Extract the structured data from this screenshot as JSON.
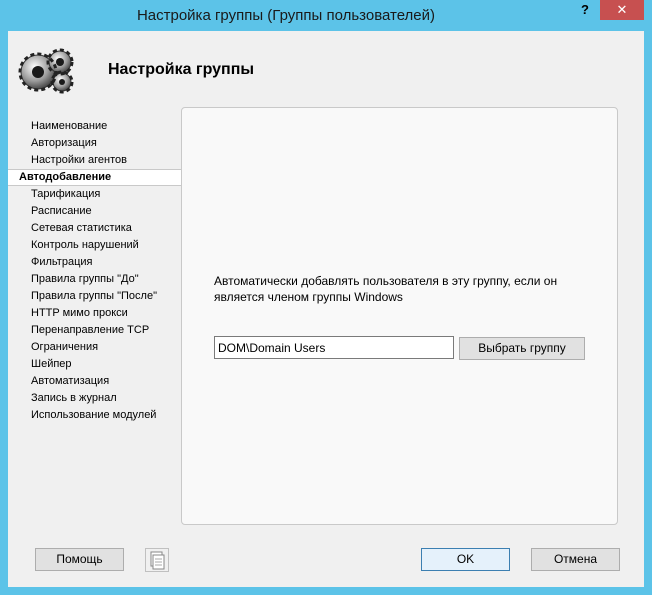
{
  "window": {
    "title": "Настройка группы (Группы пользователей)",
    "help_glyph": "?",
    "close_glyph": "✕"
  },
  "header": {
    "title": "Настройка группы",
    "icon": "gears-icon"
  },
  "nav": {
    "items": [
      {
        "label": "Наименование"
      },
      {
        "label": "Авторизация"
      },
      {
        "label": "Настройки агентов"
      },
      {
        "label": "Автодобавление"
      },
      {
        "label": "Тарификация"
      },
      {
        "label": "Расписание"
      },
      {
        "label": "Сетевая статистика"
      },
      {
        "label": "Контроль нарушений"
      },
      {
        "label": "Фильтрация"
      },
      {
        "label": "Правила группы \"До\""
      },
      {
        "label": "Правила группы \"После\""
      },
      {
        "label": "HTTP мимо прокси"
      },
      {
        "label": "Перенаправление TCP"
      },
      {
        "label": "Ограничения"
      },
      {
        "label": "Шейпер"
      },
      {
        "label": "Автоматизация"
      },
      {
        "label": "Запись в журнал"
      },
      {
        "label": "Использование модулей"
      }
    ],
    "selected": "Автодобавление"
  },
  "autoadd": {
    "description": "Автоматически добавлять пользователя в эту группу, если он является членом группы Windows",
    "group_value": "DOM\\Domain Users",
    "choose_button": "Выбрать группу"
  },
  "footer": {
    "help_button": "Помощь",
    "doc_icon": "document-icon",
    "ok_button": "OK",
    "cancel_button": "Отмена"
  },
  "colors": {
    "titlebar": "#5cc3e8",
    "close_button": "#c75050",
    "client_background": "#f0f0f0",
    "panel_background": "#f9f9f9"
  }
}
